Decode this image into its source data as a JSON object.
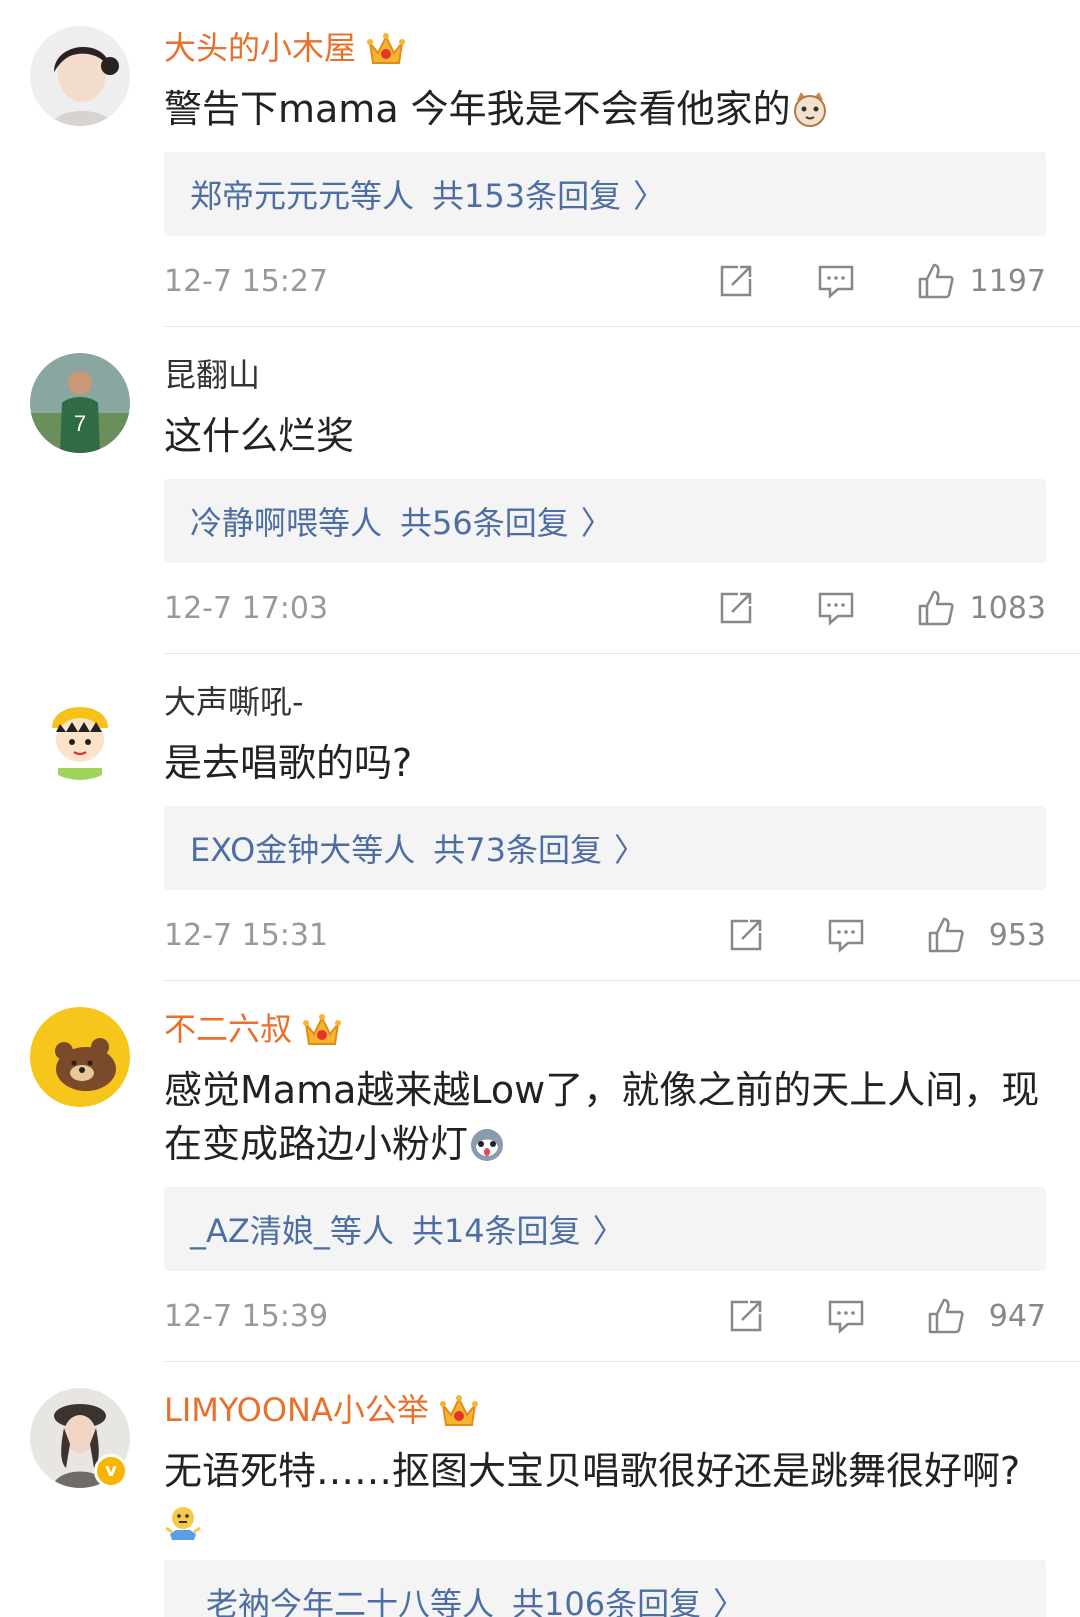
{
  "colors": {
    "vip_name": "#e8702a",
    "reply_link": "#4d6ea3",
    "timestamp": "#999999",
    "reply_bg": "#f4f4f4"
  },
  "comments": [
    {
      "username": "大头的小木屋",
      "vip": true,
      "avatar": "avatar-girl",
      "text": "警告下mama 今年我是不会看他家的",
      "emoji": "cat-face",
      "reply_who": "郑帝元元元等人",
      "reply_total": "共153条回复",
      "time": "12-7 15:27",
      "likes": "1197"
    },
    {
      "username": "昆翻山",
      "vip": false,
      "avatar": "avatar-footballer",
      "text": "这什么烂奖",
      "reply_who": "冷静啊喂等人",
      "reply_total": "共56条回复",
      "time": "12-7 17:03",
      "likes": "1083"
    },
    {
      "username": "大声嘶吼-",
      "vip": false,
      "avatar": "avatar-cartoon-kid",
      "text": "是去唱歌的吗?",
      "reply_who": "EXO金钟大等人",
      "reply_total": "共73条回复",
      "time": "12-7 15:31",
      "likes": "953"
    },
    {
      "username": "不二六叔",
      "vip": true,
      "avatar": "avatar-bear",
      "text": "感觉Mama越来越Low了，就像之前的天上人间，现在变成路边小粉灯",
      "emoji": "husky-face",
      "reply_who": "_AZ清娘_等人",
      "reply_total": "共14条回复",
      "time": "12-7 15:39",
      "likes": "947"
    },
    {
      "username": "LIMYOONA小公举",
      "vip": true,
      "verified": true,
      "avatar": "avatar-woman-hat",
      "text": "无语死特……抠图大宝贝唱歌很好还是跳舞很好啊?",
      "emoji": "shrug-face",
      "reply_who": "_老衲今年二十八等人",
      "reply_total": "共106条回复"
    }
  ]
}
